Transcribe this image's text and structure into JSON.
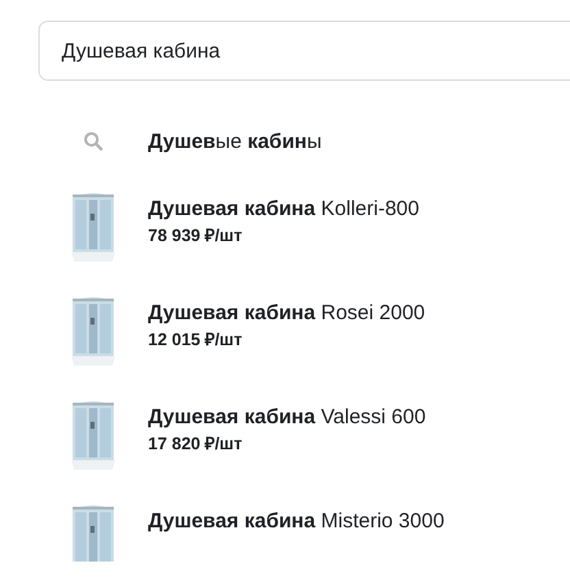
{
  "search": {
    "value": "Душевая кабина"
  },
  "suggestion": {
    "text": "**Душев**ые **кабин**ы"
  },
  "products": [
    {
      "kind": "picture",
      "title": "**Душевая кабина** Kolleri-800",
      "price": "78 939 ₽/шт"
    },
    {
      "kind": "picture",
      "title": "**Душевая кабина** Rosei 2000",
      "price": "12 015 ₽/шт"
    },
    {
      "kind": "picture",
      "title": "**Душевая кабина** Valessi 600",
      "price": "17 820 ₽/шт"
    },
    {
      "kind": "picture",
      "title": "**Душевая кабина** Misterio 3000"
    }
  ]
}
